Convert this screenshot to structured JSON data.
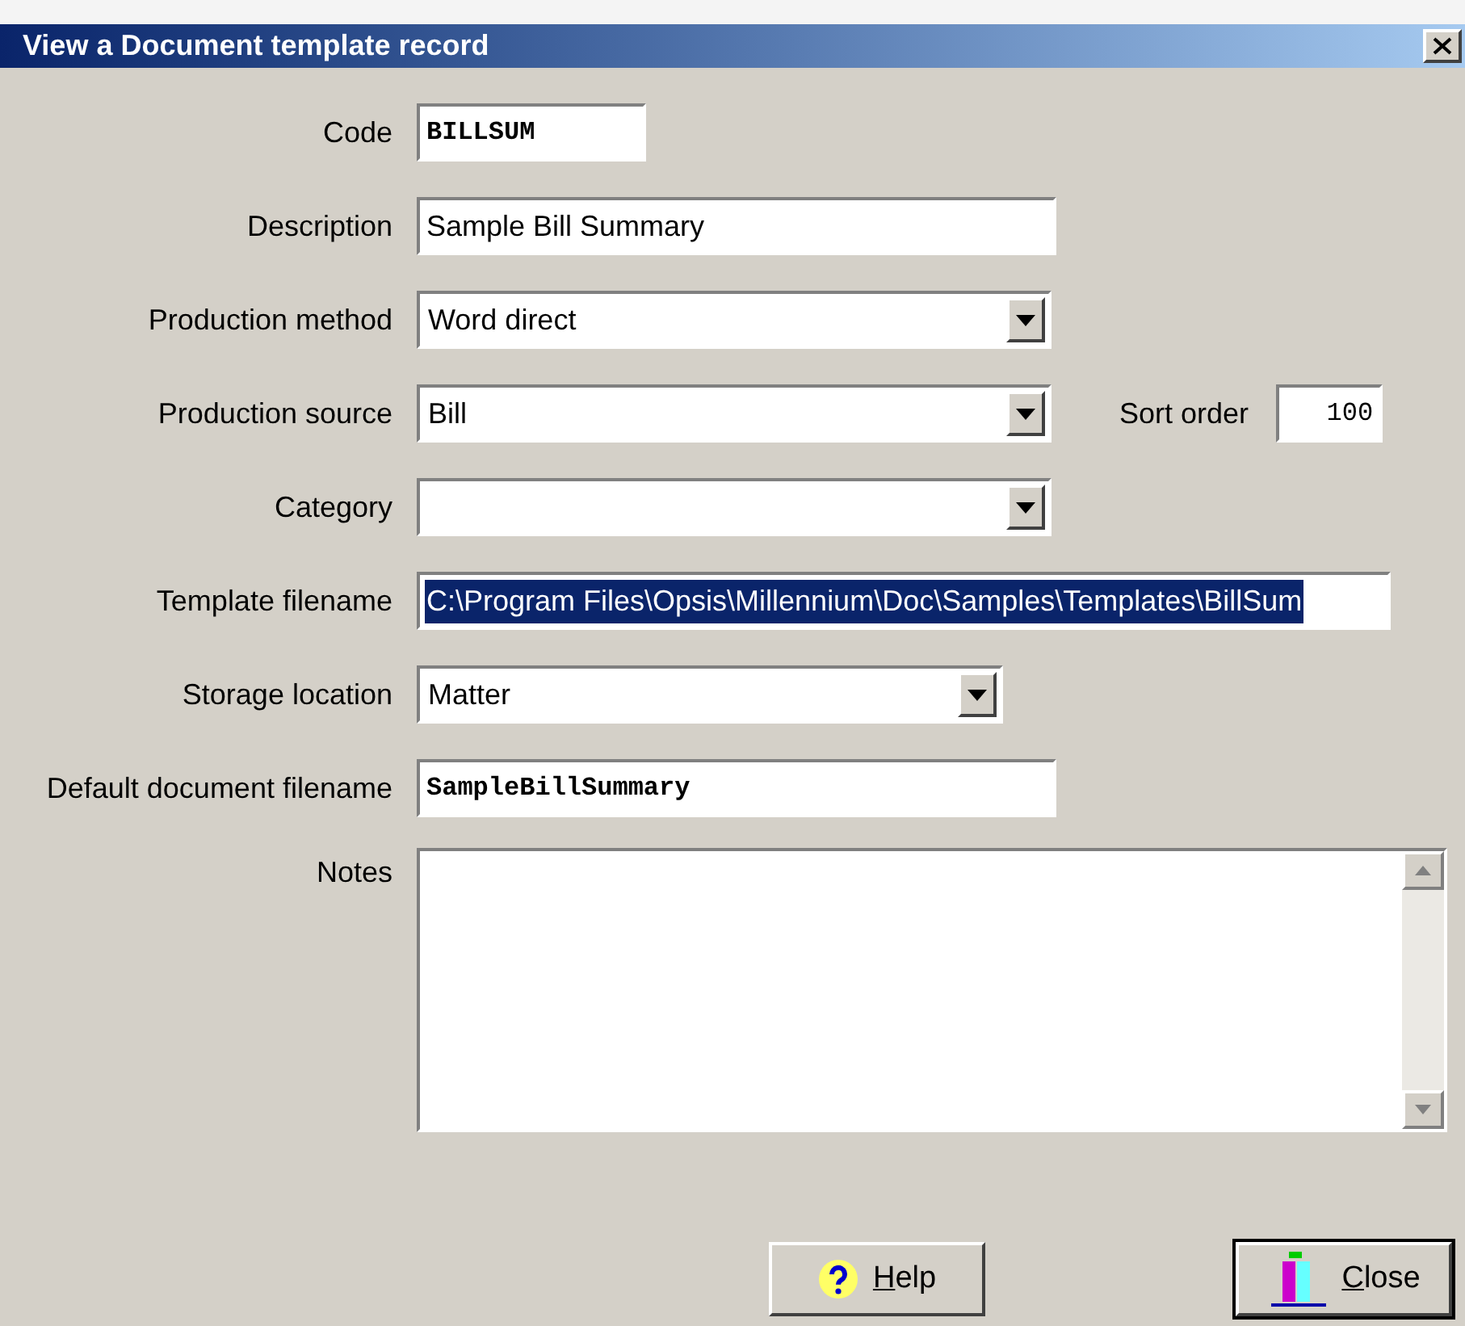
{
  "window": {
    "title": "View a Document template record"
  },
  "fields": [
    {
      "label": "Code",
      "kind": "text",
      "value": "BILLSUM",
      "mono": true,
      "highlighted": false
    },
    {
      "label": "Description",
      "kind": "text",
      "value": "Sample Bill Summary",
      "mono": false,
      "highlighted": false
    },
    {
      "label": "Production method",
      "kind": "select",
      "value": "Word direct"
    },
    {
      "label": "Production source",
      "kind": "select",
      "value": "Bill",
      "extra": {
        "label": "Sort order",
        "value": "100"
      }
    },
    {
      "label": "Category",
      "kind": "select"
    },
    {
      "label": "Template filename",
      "kind": "text",
      "value": "C:\\Program Files\\Opsis\\Millennium\\Doc\\Samples\\Templates\\BillSum",
      "mono": false,
      "highlighted": true
    },
    {
      "label": "Storage location",
      "kind": "select",
      "value": "Matter"
    },
    {
      "label": "Default document filename",
      "kind": "text",
      "value": "SampleBillSummary",
      "mono": true,
      "highlighted": false
    }
  ],
  "notes": {
    "label": "Notes"
  },
  "buttons": [
    {
      "label": "Help",
      "kind": "help",
      "default": false
    },
    {
      "label": "Close",
      "kind": "close",
      "default": true
    }
  ]
}
